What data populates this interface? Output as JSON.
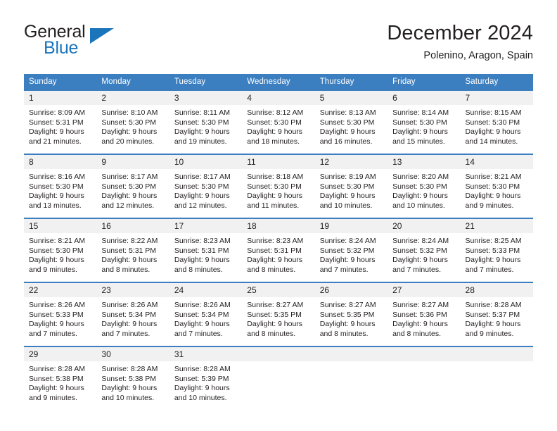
{
  "brand": {
    "line1": "General",
    "line2": "Blue",
    "triangle_color": "#1b75bb",
    "text_color": "#231f20"
  },
  "header": {
    "title": "December 2024",
    "subtitle": "Polenino, Aragon, Spain"
  },
  "theme": {
    "header_blue": "#3c7fc0",
    "row_border_blue": "#3c7fc0",
    "daynum_band": "#f1f1f1",
    "text": "#231f20"
  },
  "labels": {
    "sunrise_prefix": "Sunrise:",
    "sunset_prefix": "Sunset:",
    "daylight_prefix": "Daylight:"
  },
  "weekday_headers": [
    "Sunday",
    "Monday",
    "Tuesday",
    "Wednesday",
    "Thursday",
    "Friday",
    "Saturday"
  ],
  "weeks": [
    [
      {
        "day": "1",
        "sunrise": "Sunrise: 8:09 AM",
        "sunset": "Sunset: 5:31 PM",
        "daylight_line1": "Daylight: 9 hours",
        "daylight_line2": "and 21 minutes."
      },
      {
        "day": "2",
        "sunrise": "Sunrise: 8:10 AM",
        "sunset": "Sunset: 5:30 PM",
        "daylight_line1": "Daylight: 9 hours",
        "daylight_line2": "and 20 minutes."
      },
      {
        "day": "3",
        "sunrise": "Sunrise: 8:11 AM",
        "sunset": "Sunset: 5:30 PM",
        "daylight_line1": "Daylight: 9 hours",
        "daylight_line2": "and 19 minutes."
      },
      {
        "day": "4",
        "sunrise": "Sunrise: 8:12 AM",
        "sunset": "Sunset: 5:30 PM",
        "daylight_line1": "Daylight: 9 hours",
        "daylight_line2": "and 18 minutes."
      },
      {
        "day": "5",
        "sunrise": "Sunrise: 8:13 AM",
        "sunset": "Sunset: 5:30 PM",
        "daylight_line1": "Daylight: 9 hours",
        "daylight_line2": "and 16 minutes."
      },
      {
        "day": "6",
        "sunrise": "Sunrise: 8:14 AM",
        "sunset": "Sunset: 5:30 PM",
        "daylight_line1": "Daylight: 9 hours",
        "daylight_line2": "and 15 minutes."
      },
      {
        "day": "7",
        "sunrise": "Sunrise: 8:15 AM",
        "sunset": "Sunset: 5:30 PM",
        "daylight_line1": "Daylight: 9 hours",
        "daylight_line2": "and 14 minutes."
      }
    ],
    [
      {
        "day": "8",
        "sunrise": "Sunrise: 8:16 AM",
        "sunset": "Sunset: 5:30 PM",
        "daylight_line1": "Daylight: 9 hours",
        "daylight_line2": "and 13 minutes."
      },
      {
        "day": "9",
        "sunrise": "Sunrise: 8:17 AM",
        "sunset": "Sunset: 5:30 PM",
        "daylight_line1": "Daylight: 9 hours",
        "daylight_line2": "and 12 minutes."
      },
      {
        "day": "10",
        "sunrise": "Sunrise: 8:17 AM",
        "sunset": "Sunset: 5:30 PM",
        "daylight_line1": "Daylight: 9 hours",
        "daylight_line2": "and 12 minutes."
      },
      {
        "day": "11",
        "sunrise": "Sunrise: 8:18 AM",
        "sunset": "Sunset: 5:30 PM",
        "daylight_line1": "Daylight: 9 hours",
        "daylight_line2": "and 11 minutes."
      },
      {
        "day": "12",
        "sunrise": "Sunrise: 8:19 AM",
        "sunset": "Sunset: 5:30 PM",
        "daylight_line1": "Daylight: 9 hours",
        "daylight_line2": "and 10 minutes."
      },
      {
        "day": "13",
        "sunrise": "Sunrise: 8:20 AM",
        "sunset": "Sunset: 5:30 PM",
        "daylight_line1": "Daylight: 9 hours",
        "daylight_line2": "and 10 minutes."
      },
      {
        "day": "14",
        "sunrise": "Sunrise: 8:21 AM",
        "sunset": "Sunset: 5:30 PM",
        "daylight_line1": "Daylight: 9 hours",
        "daylight_line2": "and 9 minutes."
      }
    ],
    [
      {
        "day": "15",
        "sunrise": "Sunrise: 8:21 AM",
        "sunset": "Sunset: 5:30 PM",
        "daylight_line1": "Daylight: 9 hours",
        "daylight_line2": "and 9 minutes."
      },
      {
        "day": "16",
        "sunrise": "Sunrise: 8:22 AM",
        "sunset": "Sunset: 5:31 PM",
        "daylight_line1": "Daylight: 9 hours",
        "daylight_line2": "and 8 minutes."
      },
      {
        "day": "17",
        "sunrise": "Sunrise: 8:23 AM",
        "sunset": "Sunset: 5:31 PM",
        "daylight_line1": "Daylight: 9 hours",
        "daylight_line2": "and 8 minutes."
      },
      {
        "day": "18",
        "sunrise": "Sunrise: 8:23 AM",
        "sunset": "Sunset: 5:31 PM",
        "daylight_line1": "Daylight: 9 hours",
        "daylight_line2": "and 8 minutes."
      },
      {
        "day": "19",
        "sunrise": "Sunrise: 8:24 AM",
        "sunset": "Sunset: 5:32 PM",
        "daylight_line1": "Daylight: 9 hours",
        "daylight_line2": "and 7 minutes."
      },
      {
        "day": "20",
        "sunrise": "Sunrise: 8:24 AM",
        "sunset": "Sunset: 5:32 PM",
        "daylight_line1": "Daylight: 9 hours",
        "daylight_line2": "and 7 minutes."
      },
      {
        "day": "21",
        "sunrise": "Sunrise: 8:25 AM",
        "sunset": "Sunset: 5:33 PM",
        "daylight_line1": "Daylight: 9 hours",
        "daylight_line2": "and 7 minutes."
      }
    ],
    [
      {
        "day": "22",
        "sunrise": "Sunrise: 8:26 AM",
        "sunset": "Sunset: 5:33 PM",
        "daylight_line1": "Daylight: 9 hours",
        "daylight_line2": "and 7 minutes."
      },
      {
        "day": "23",
        "sunrise": "Sunrise: 8:26 AM",
        "sunset": "Sunset: 5:34 PM",
        "daylight_line1": "Daylight: 9 hours",
        "daylight_line2": "and 7 minutes."
      },
      {
        "day": "24",
        "sunrise": "Sunrise: 8:26 AM",
        "sunset": "Sunset: 5:34 PM",
        "daylight_line1": "Daylight: 9 hours",
        "daylight_line2": "and 7 minutes."
      },
      {
        "day": "25",
        "sunrise": "Sunrise: 8:27 AM",
        "sunset": "Sunset: 5:35 PM",
        "daylight_line1": "Daylight: 9 hours",
        "daylight_line2": "and 8 minutes."
      },
      {
        "day": "26",
        "sunrise": "Sunrise: 8:27 AM",
        "sunset": "Sunset: 5:35 PM",
        "daylight_line1": "Daylight: 9 hours",
        "daylight_line2": "and 8 minutes."
      },
      {
        "day": "27",
        "sunrise": "Sunrise: 8:27 AM",
        "sunset": "Sunset: 5:36 PM",
        "daylight_line1": "Daylight: 9 hours",
        "daylight_line2": "and 8 minutes."
      },
      {
        "day": "28",
        "sunrise": "Sunrise: 8:28 AM",
        "sunset": "Sunset: 5:37 PM",
        "daylight_line1": "Daylight: 9 hours",
        "daylight_line2": "and 9 minutes."
      }
    ],
    [
      {
        "day": "29",
        "sunrise": "Sunrise: 8:28 AM",
        "sunset": "Sunset: 5:38 PM",
        "daylight_line1": "Daylight: 9 hours",
        "daylight_line2": "and 9 minutes."
      },
      {
        "day": "30",
        "sunrise": "Sunrise: 8:28 AM",
        "sunset": "Sunset: 5:38 PM",
        "daylight_line1": "Daylight: 9 hours",
        "daylight_line2": "and 10 minutes."
      },
      {
        "day": "31",
        "sunrise": "Sunrise: 8:28 AM",
        "sunset": "Sunset: 5:39 PM",
        "daylight_line1": "Daylight: 9 hours",
        "daylight_line2": "and 10 minutes."
      },
      {
        "day": "",
        "sunrise": "",
        "sunset": "",
        "daylight_line1": "",
        "daylight_line2": ""
      },
      {
        "day": "",
        "sunrise": "",
        "sunset": "",
        "daylight_line1": "",
        "daylight_line2": ""
      },
      {
        "day": "",
        "sunrise": "",
        "sunset": "",
        "daylight_line1": "",
        "daylight_line2": ""
      },
      {
        "day": "",
        "sunrise": "",
        "sunset": "",
        "daylight_line1": "",
        "daylight_line2": ""
      }
    ]
  ]
}
